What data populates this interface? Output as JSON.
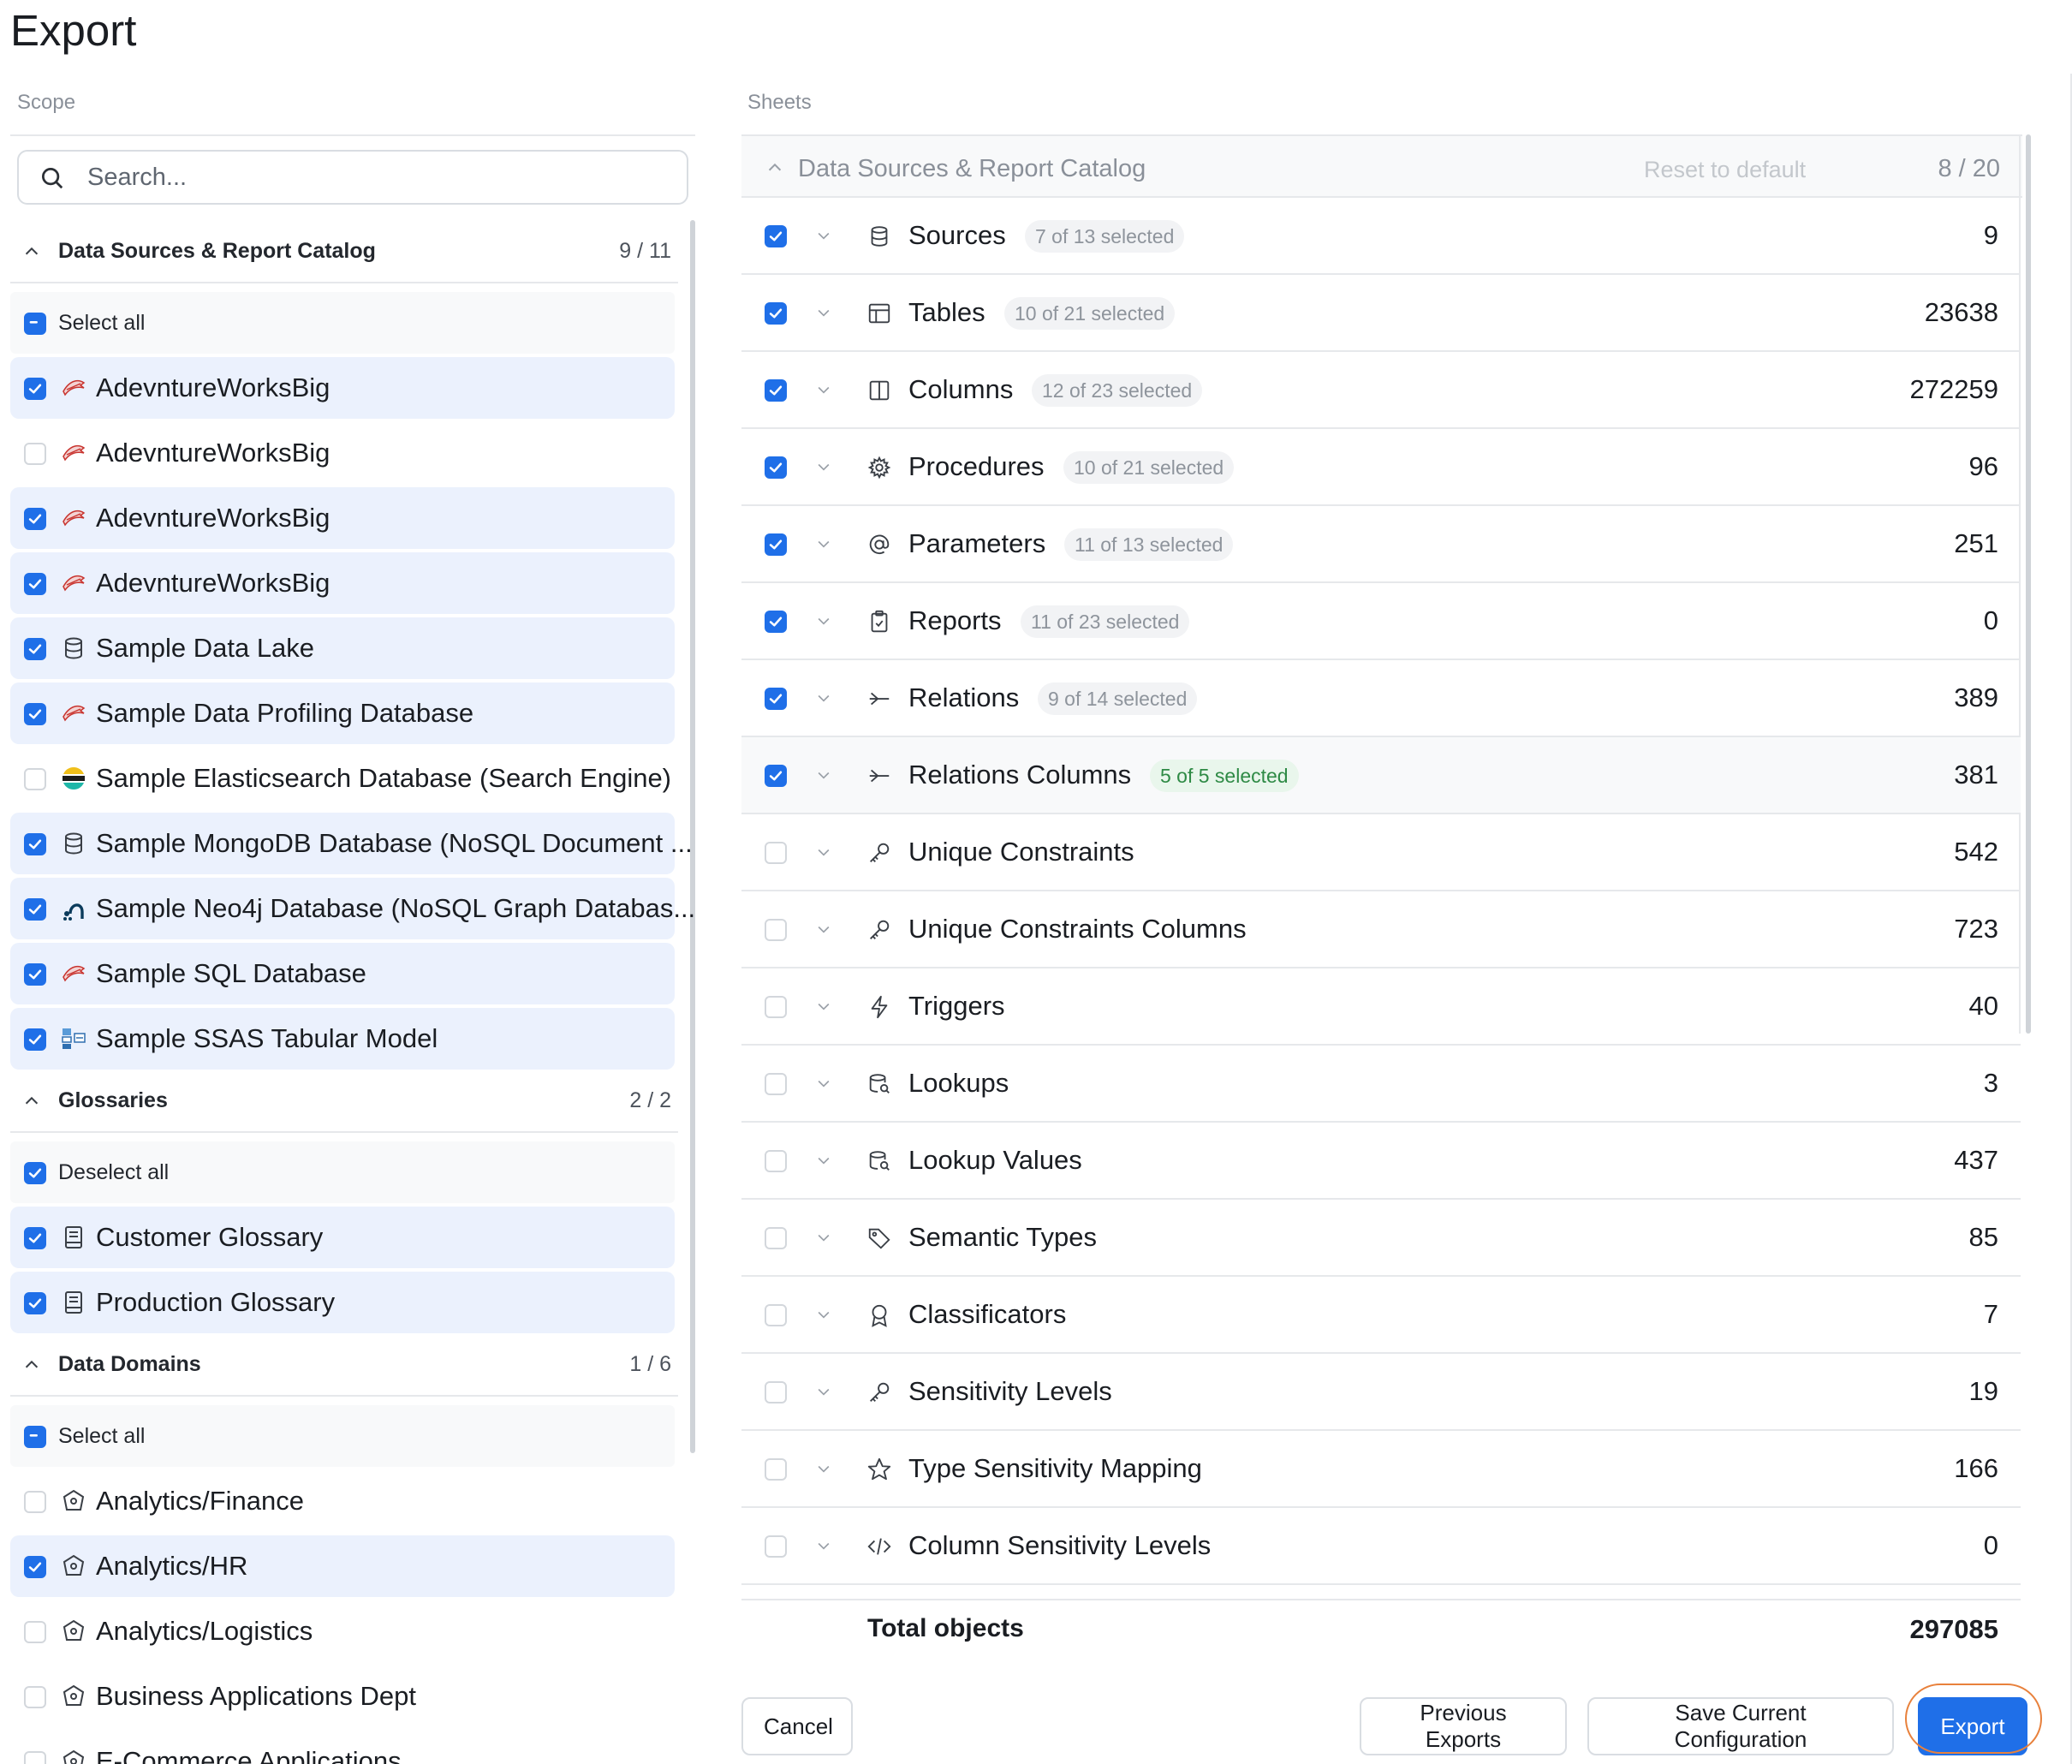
{
  "title": "Export",
  "scope": {
    "label": "Scope",
    "search_placeholder": "Search...",
    "sections": [
      {
        "name": "Data Sources & Report Catalog",
        "count": "9 / 11",
        "select_label": "Select all",
        "select_state": "indeterminate",
        "items": [
          {
            "label": "AdevntureWorksBig",
            "checked": true,
            "icon": "sql-server-icon"
          },
          {
            "label": "AdevntureWorksBig",
            "checked": false,
            "icon": "sql-server-icon"
          },
          {
            "label": "AdevntureWorksBig",
            "checked": true,
            "icon": "sql-server-icon"
          },
          {
            "label": "AdevntureWorksBig",
            "checked": true,
            "icon": "sql-server-icon"
          },
          {
            "label": "Sample Data Lake",
            "checked": true,
            "icon": "database-icon"
          },
          {
            "label": "Sample Data Profiling Database",
            "checked": true,
            "icon": "sql-server-icon"
          },
          {
            "label": "Sample Elasticsearch Database (Search Engine)",
            "checked": false,
            "icon": "elasticsearch-icon"
          },
          {
            "label": "Sample MongoDB Database (NoSQL Document ...",
            "checked": true,
            "icon": "database-icon"
          },
          {
            "label": "Sample Neo4j Database (NoSQL Graph Databas...",
            "checked": true,
            "icon": "neo4j-icon"
          },
          {
            "label": "Sample SQL Database",
            "checked": true,
            "icon": "sql-server-icon"
          },
          {
            "label": "Sample SSAS Tabular Model",
            "checked": true,
            "icon": "ssas-icon"
          }
        ]
      },
      {
        "name": "Glossaries",
        "count": "2 / 2",
        "select_label": "Deselect all",
        "select_state": "checked",
        "items": [
          {
            "label": "Customer Glossary",
            "checked": true,
            "icon": "book-icon"
          },
          {
            "label": "Production Glossary",
            "checked": true,
            "icon": "book-icon"
          }
        ]
      },
      {
        "name": "Data Domains",
        "count": "1 / 6",
        "select_label": "Select all",
        "select_state": "indeterminate",
        "items": [
          {
            "label": "Analytics/Finance",
            "checked": false,
            "icon": "domain-icon"
          },
          {
            "label": "Analytics/HR",
            "checked": true,
            "icon": "domain-icon"
          },
          {
            "label": "Analytics/Logistics",
            "checked": false,
            "icon": "domain-icon"
          },
          {
            "label": "Business Applications Dept",
            "checked": false,
            "icon": "domain-icon"
          },
          {
            "label": "E-Commerce Applications",
            "checked": false,
            "icon": "domain-icon"
          }
        ]
      }
    ]
  },
  "sheets": {
    "label": "Sheets",
    "header": {
      "name": "Data Sources & Report Catalog",
      "reset": "Reset to default",
      "count": "8 / 20"
    },
    "rows": [
      {
        "label": "Sources",
        "badge": "7 of 13 selected",
        "badge_style": "gray",
        "value": "9",
        "checked": true,
        "icon": "database-icon"
      },
      {
        "label": "Tables",
        "badge": "10 of 21 selected",
        "badge_style": "gray",
        "value": "23638",
        "checked": true,
        "icon": "table-icon"
      },
      {
        "label": "Columns",
        "badge": "12 of 23 selected",
        "badge_style": "gray",
        "value": "272259",
        "checked": true,
        "icon": "columns-icon"
      },
      {
        "label": "Procedures",
        "badge": "10 of 21 selected",
        "badge_style": "gray",
        "value": "96",
        "checked": true,
        "icon": "gear-icon"
      },
      {
        "label": "Parameters",
        "badge": "11 of 13 selected",
        "badge_style": "gray",
        "value": "251",
        "checked": true,
        "icon": "at-icon"
      },
      {
        "label": "Reports",
        "badge": "11 of 23 selected",
        "badge_style": "gray",
        "value": "0",
        "checked": true,
        "icon": "clipboard-icon"
      },
      {
        "label": "Relations",
        "badge": "9 of 14 selected",
        "badge_style": "gray",
        "value": "389",
        "checked": true,
        "icon": "relation-icon"
      },
      {
        "label": "Relations Columns",
        "badge": "5 of 5 selected",
        "badge_style": "green",
        "value": "381",
        "checked": true,
        "icon": "relation-icon"
      },
      {
        "label": "Unique Constraints",
        "badge": "",
        "badge_style": "",
        "value": "542",
        "checked": false,
        "icon": "key-icon"
      },
      {
        "label": "Unique Constraints Columns",
        "badge": "",
        "badge_style": "",
        "value": "723",
        "checked": false,
        "icon": "key-icon"
      },
      {
        "label": "Triggers",
        "badge": "",
        "badge_style": "",
        "value": "40",
        "checked": false,
        "icon": "bolt-icon"
      },
      {
        "label": "Lookups",
        "badge": "",
        "badge_style": "",
        "value": "3",
        "checked": false,
        "icon": "lookup-icon"
      },
      {
        "label": "Lookup Values",
        "badge": "",
        "badge_style": "",
        "value": "437",
        "checked": false,
        "icon": "lookup-icon"
      },
      {
        "label": "Semantic Types",
        "badge": "",
        "badge_style": "",
        "value": "85",
        "checked": false,
        "icon": "tag-icon"
      },
      {
        "label": "Classificators",
        "badge": "",
        "badge_style": "",
        "value": "7",
        "checked": false,
        "icon": "award-icon"
      },
      {
        "label": "Sensitivity Levels",
        "badge": "",
        "badge_style": "",
        "value": "19",
        "checked": false,
        "icon": "key-icon"
      },
      {
        "label": "Type Sensitivity Mapping",
        "badge": "",
        "badge_style": "",
        "value": "166",
        "checked": false,
        "icon": "star-icon"
      },
      {
        "label": "Column Sensitivity Levels",
        "badge": "",
        "badge_style": "",
        "value": "0",
        "checked": false,
        "icon": "code-icon"
      }
    ],
    "total_label": "Total objects",
    "total_value": "297085"
  },
  "buttons": {
    "cancel": "Cancel",
    "previous": "Previous Exports",
    "save_config": "Save Current Configuration",
    "export": "Export"
  },
  "colors": {
    "accent": "#1f6fe8",
    "selected_row": "#ebf1fd",
    "focus_ring": "#e8813c",
    "badge_green": "#2e8a45"
  }
}
